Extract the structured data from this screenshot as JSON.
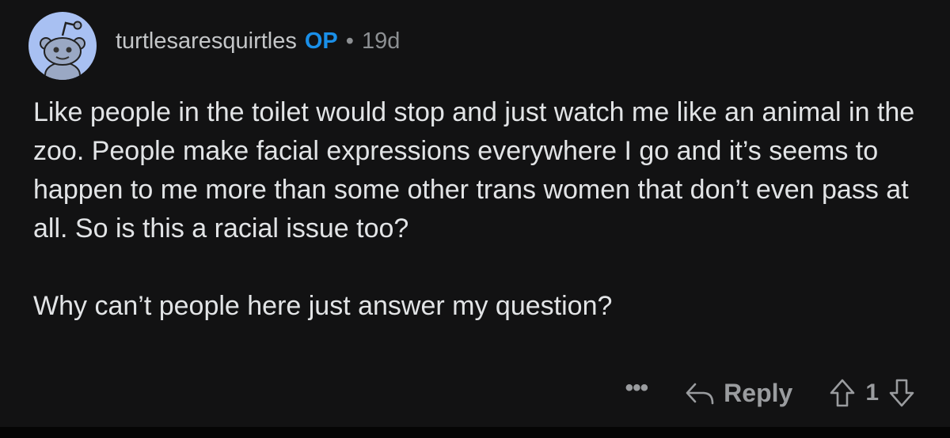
{
  "comment": {
    "author": "turtlesaresquirtles",
    "op_badge": "OP",
    "separator": "•",
    "age": "19d",
    "paragraphs": [
      "Like people in the toilet would stop and just watch me like an animal in the zoo. People make facial expressions everywhere I go and it’s seems to happen to me more than some other trans women that don’t even pass at all. So is this a racial issue too?",
      "Why can’t people here just answer my question?"
    ]
  },
  "actions": {
    "more_label": "•••",
    "reply_label": "Reply",
    "score": "1"
  },
  "colors": {
    "background": "#121213",
    "op_accent": "#1a8fe8",
    "avatar_bg": "#a8c0f2"
  },
  "icons": [
    "snoo-avatar-icon",
    "reply-arrow-icon",
    "upvote-icon",
    "downvote-icon"
  ]
}
